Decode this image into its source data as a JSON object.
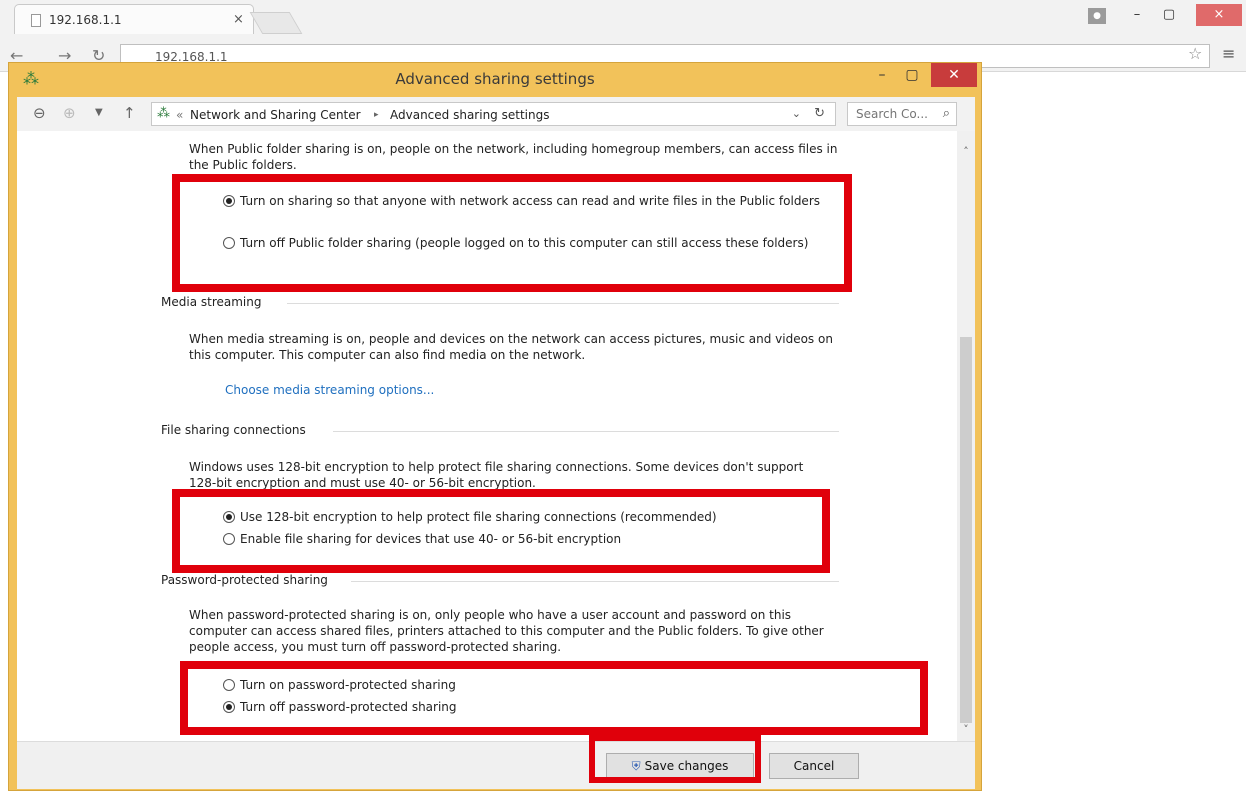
{
  "browser": {
    "tab_title": "192.168.1.1",
    "tab_close": "×",
    "address": "192.168.1.1",
    "window_min": "–",
    "window_max": "▢",
    "window_close": "×"
  },
  "window": {
    "title": "Advanced sharing settings",
    "min": "–",
    "max": "▢",
    "close": "✕"
  },
  "address_bar": {
    "prefix": "«",
    "crumbs": [
      "Network and Sharing Center",
      "Advanced sharing settings"
    ],
    "separator": "▸",
    "search_placeholder": "Search Co..."
  },
  "public_folder": {
    "intro": "When Public folder sharing is on, people on the network, including homegroup members, can access files in the Public folders.",
    "options": [
      {
        "label": "Turn on sharing so that anyone with network access can read and write files in the Public folders",
        "selected": true
      },
      {
        "label": "Turn off Public folder sharing (people logged on to this computer can still access these folders)",
        "selected": false
      }
    ]
  },
  "media_streaming": {
    "title": "Media streaming",
    "description": "When media streaming is on, people and devices on the network can access pictures, music and videos on this computer. This computer can also find media on the network.",
    "link": "Choose media streaming options..."
  },
  "file_sharing": {
    "title": "File sharing connections",
    "description": "Windows uses 128-bit encryption to help protect file sharing connections. Some devices don't support 128-bit encryption and must use 40- or 56-bit encryption.",
    "options": [
      {
        "label": "Use 128-bit encryption to help protect file sharing connections (recommended)",
        "selected": true
      },
      {
        "label": "Enable file sharing for devices that use 40- or 56-bit encryption",
        "selected": false
      }
    ]
  },
  "password_sharing": {
    "title": "Password-protected sharing",
    "description": "When password-protected sharing is on, only people who have a user account and password on this computer can access shared files, printers attached to this computer and the Public folders. To give other people access, you must turn off password-protected sharing.",
    "options": [
      {
        "label": "Turn on password-protected sharing",
        "selected": false
      },
      {
        "label": "Turn off password-protected sharing",
        "selected": true
      }
    ]
  },
  "footer": {
    "save": "Save changes",
    "cancel": "Cancel"
  },
  "colors": {
    "highlight": "#e0000b",
    "window_frame": "#f2c25a",
    "link": "#1f6fbf"
  }
}
